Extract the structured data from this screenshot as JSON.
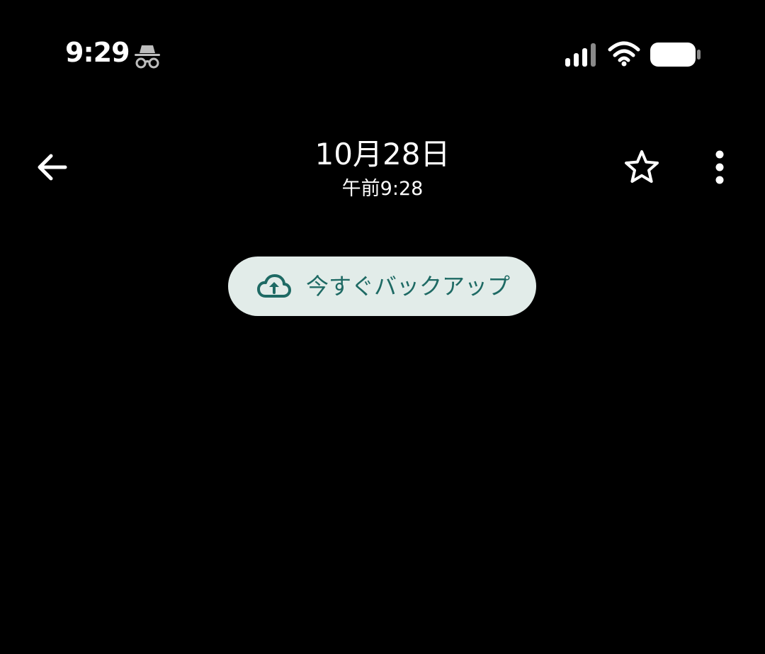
{
  "status_bar": {
    "time": "9:29",
    "icons": [
      "incognito-icon",
      "signal-icon",
      "wifi-icon",
      "battery-icon"
    ]
  },
  "app_bar": {
    "title": "10月28日",
    "subtitle": "午前9:28",
    "icons": {
      "back": "arrow-back-icon",
      "star": "star-outline-icon",
      "more": "more-vert-icon"
    }
  },
  "backup_chip": {
    "label": "今すぐバックアップ",
    "icon": "cloud-upload-icon"
  },
  "colors": {
    "background": "#000000",
    "foreground": "#ffffff",
    "chip_bg": "#e2ece9",
    "chip_fg": "#1e6a64"
  }
}
